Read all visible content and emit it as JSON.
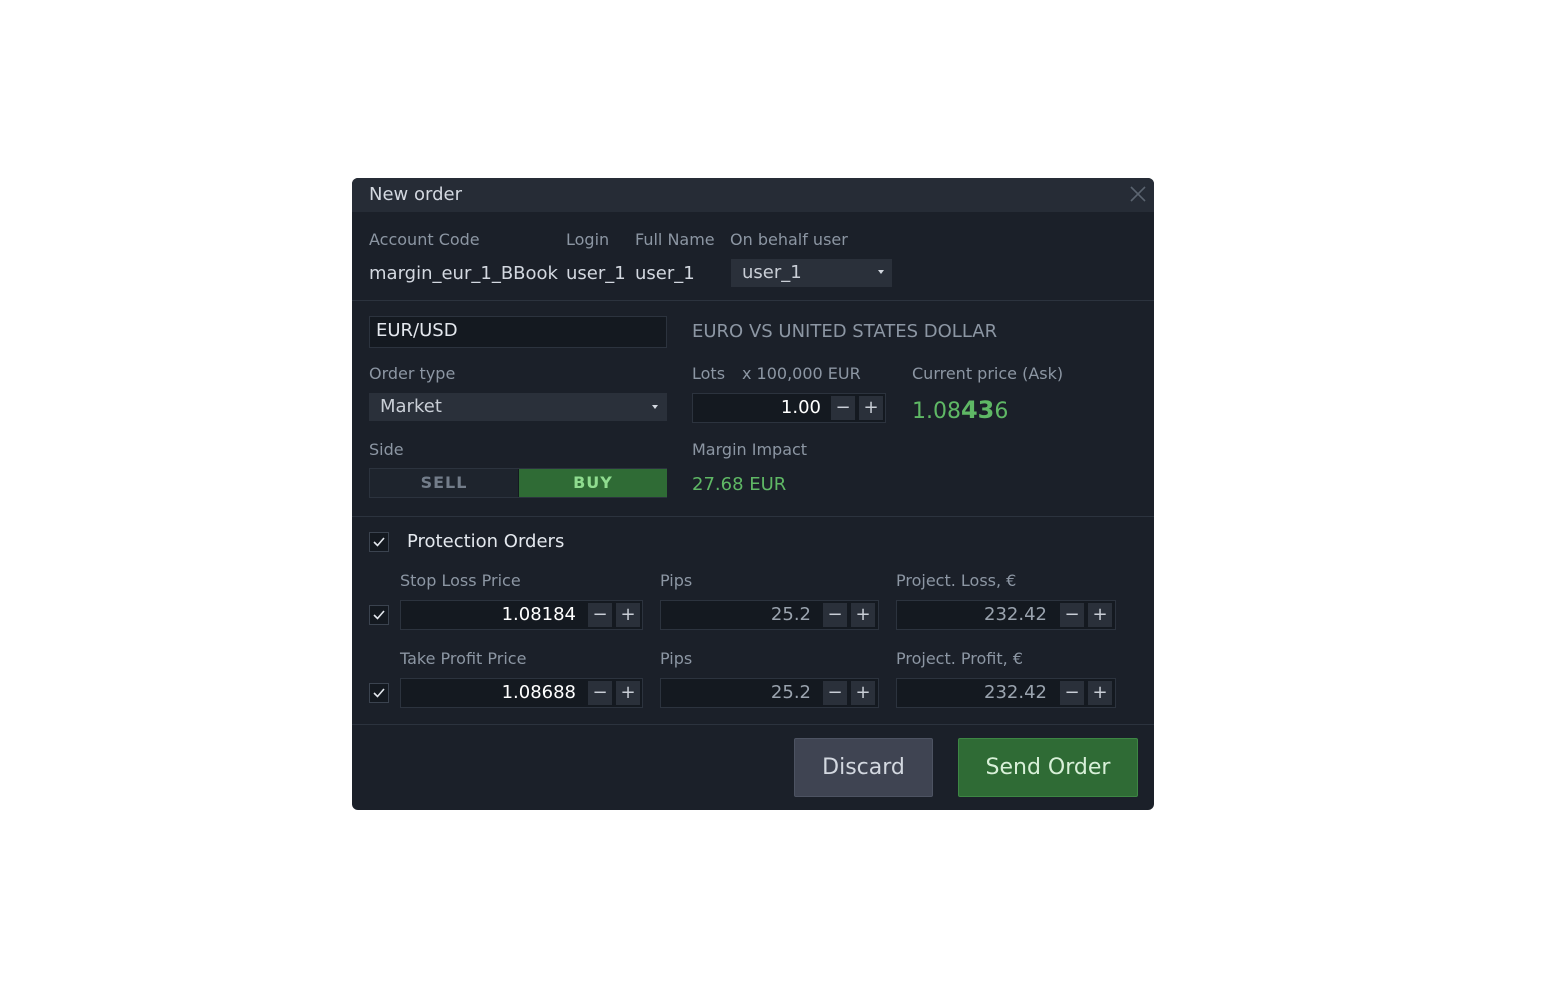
{
  "dialog": {
    "title": "New order",
    "close_icon": "close-icon"
  },
  "account": {
    "code_label": "Account Code",
    "code_value": "margin_eur_1_BBook",
    "login_label": "Login",
    "login_value": "user_1",
    "fullname_label": "Full Name",
    "fullname_value": "user_1",
    "behalf_label": "On behalf user",
    "behalf_value": "user_1"
  },
  "instrument": {
    "symbol": "EUR/USD",
    "description": "EURO VS UNITED STATES DOLLAR"
  },
  "order": {
    "type_label": "Order type",
    "type_value": "Market",
    "lots_label": "Lots",
    "lots_unit": "x 100,000 EUR",
    "lots_value": "1.00",
    "price_label": "Current price (Ask)",
    "price_prefix": "1.08",
    "price_big": "43",
    "price_suffix": "6",
    "side_label": "Side",
    "sell_label": "SELL",
    "buy_label": "BUY",
    "selected_side": "BUY",
    "margin_label": "Margin Impact",
    "margin_value": "27.68 EUR"
  },
  "protection": {
    "title": "Protection Orders",
    "enabled": true,
    "stop_loss": {
      "enabled": true,
      "price_label": "Stop Loss Price",
      "price_value": "1.08184",
      "pips_label": "Pips",
      "pips_value": "25.2",
      "project_label": "Project. Loss, €",
      "project_value": "232.42"
    },
    "take_profit": {
      "enabled": true,
      "price_label": "Take Profit Price",
      "price_value": "1.08688",
      "pips_label": "Pips",
      "pips_value": "25.2",
      "project_label": "Project. Profit, €",
      "project_value": "232.42"
    }
  },
  "stepper": {
    "minus": "−",
    "plus": "+"
  },
  "actions": {
    "discard": "Discard",
    "send": "Send Order"
  },
  "colors": {
    "background": "#1b2029",
    "titlebar": "#262c36",
    "accent_green": "#5fb865",
    "buy_active": "#2f6b35"
  }
}
